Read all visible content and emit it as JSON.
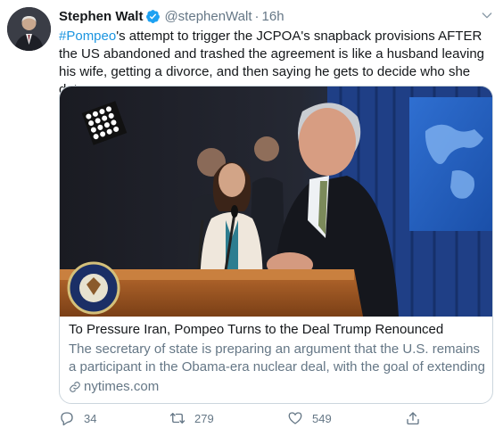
{
  "author": {
    "name": "Stephen Walt",
    "handle": "@stephenWalt",
    "separator": "·",
    "time": "16h",
    "avatar_icon": "avatar-photo",
    "verified_icon": "verified-badge-icon"
  },
  "tweet": {
    "hashtag": "#Pompeo",
    "text": "'s attempt to trigger the JCPOA's snapback provisions AFTER the US abandoned and trashed the agreement is like a husband leaving his wife, getting a divorce, and then saying he gets to decide who she dates."
  },
  "card": {
    "image_description": "photo-pompeo-at-podium",
    "title": "To Pressure Iran, Pompeo Turns to the Deal Trump Renounced",
    "description": "The secretary of state is preparing an argument that the U.S. remains a participant in the Obama-era nuclear deal, with the goal of extending a...",
    "domain": "nytimes.com"
  },
  "actions": {
    "replies": "34",
    "retweets": "279",
    "likes": "549"
  },
  "colors": {
    "link": "#1b95e0",
    "secondary": "#657786",
    "border": "#ccd6dd"
  }
}
